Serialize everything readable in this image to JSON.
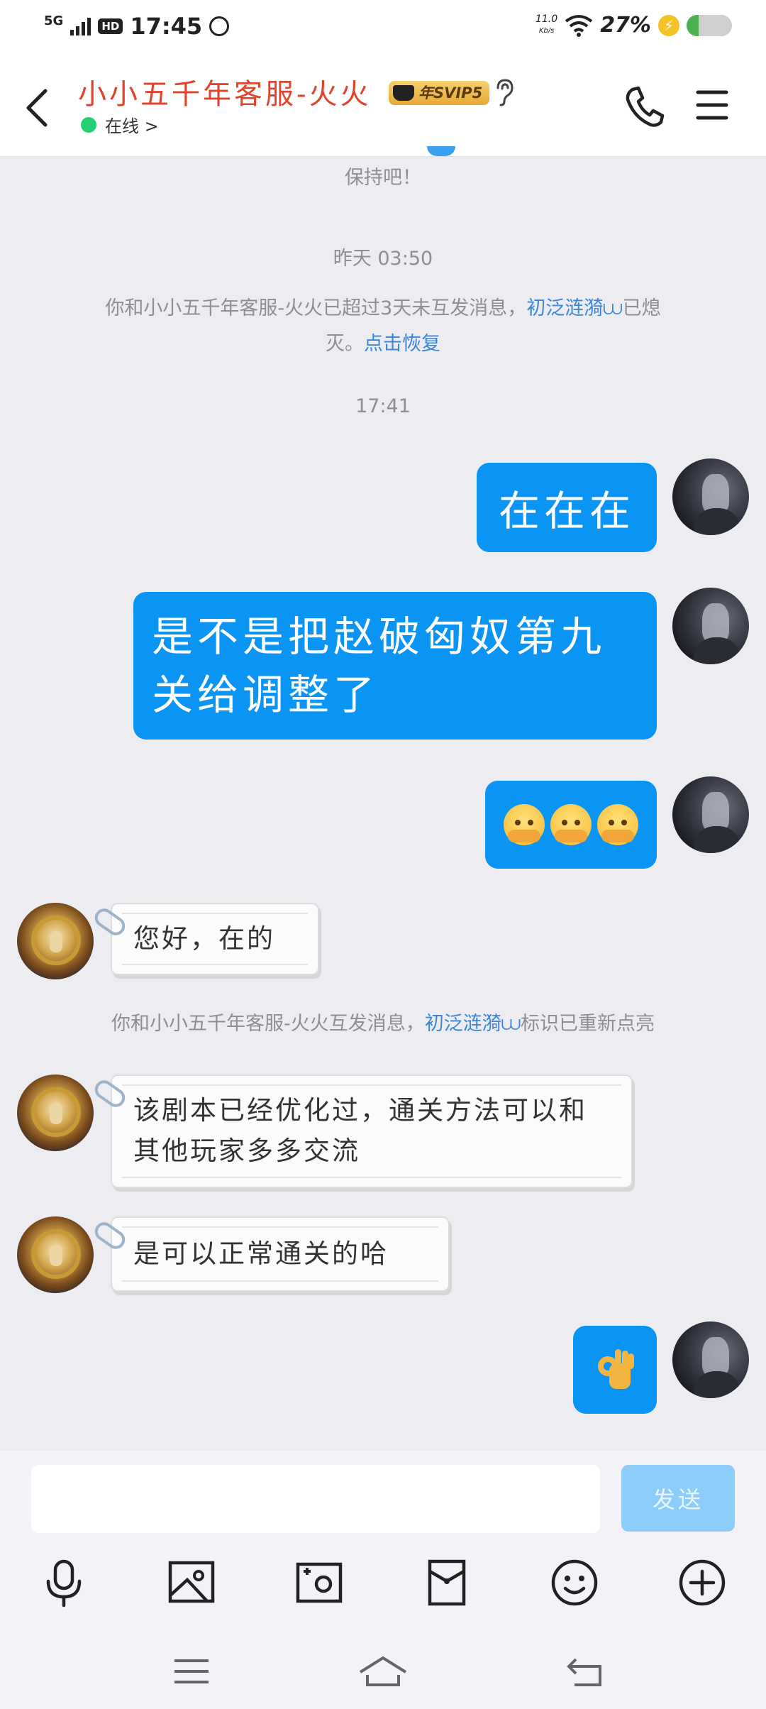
{
  "status_bar": {
    "network": "5G",
    "hd": "HD",
    "time": "17:45",
    "speed_value": "11.0",
    "speed_unit": "Kb/s",
    "battery": "27%",
    "battery_level": 0.27
  },
  "header": {
    "contact_name": "小小五千年客服-火火",
    "vip_badge": "年SVIP5",
    "status": "在线 >"
  },
  "chat": {
    "sys_prev": "保持吧！",
    "time1": "昨天 03:50",
    "notice1_pre": "你和小小五千年客服-火火已超过3天未互发消息，",
    "notice1_link": "初泛涟漪",
    "notice1_mid": "已熄",
    "notice1_tail": "灭。",
    "notice1_action": "点击恢复",
    "time2": "17:41",
    "msg1": "在在在",
    "msg2": "是不是把赵破匈奴第九关给调整了",
    "reply1": "您好，在的",
    "notice2_pre": "你和小小五千年客服-火火互发消息，",
    "notice2_link": "初泛涟漪",
    "notice2_post": "标识已重新点亮",
    "reply2": "该剧本已经优化过，通关方法可以和其他玩家多多交流",
    "reply3": "是可以正常通关的哈"
  },
  "input": {
    "placeholder": "",
    "send_label": "发送"
  },
  "colors": {
    "accent": "#0a95f5",
    "title_red": "#e0452c",
    "link_blue": "#3c86d8",
    "online_green": "#24d073"
  }
}
